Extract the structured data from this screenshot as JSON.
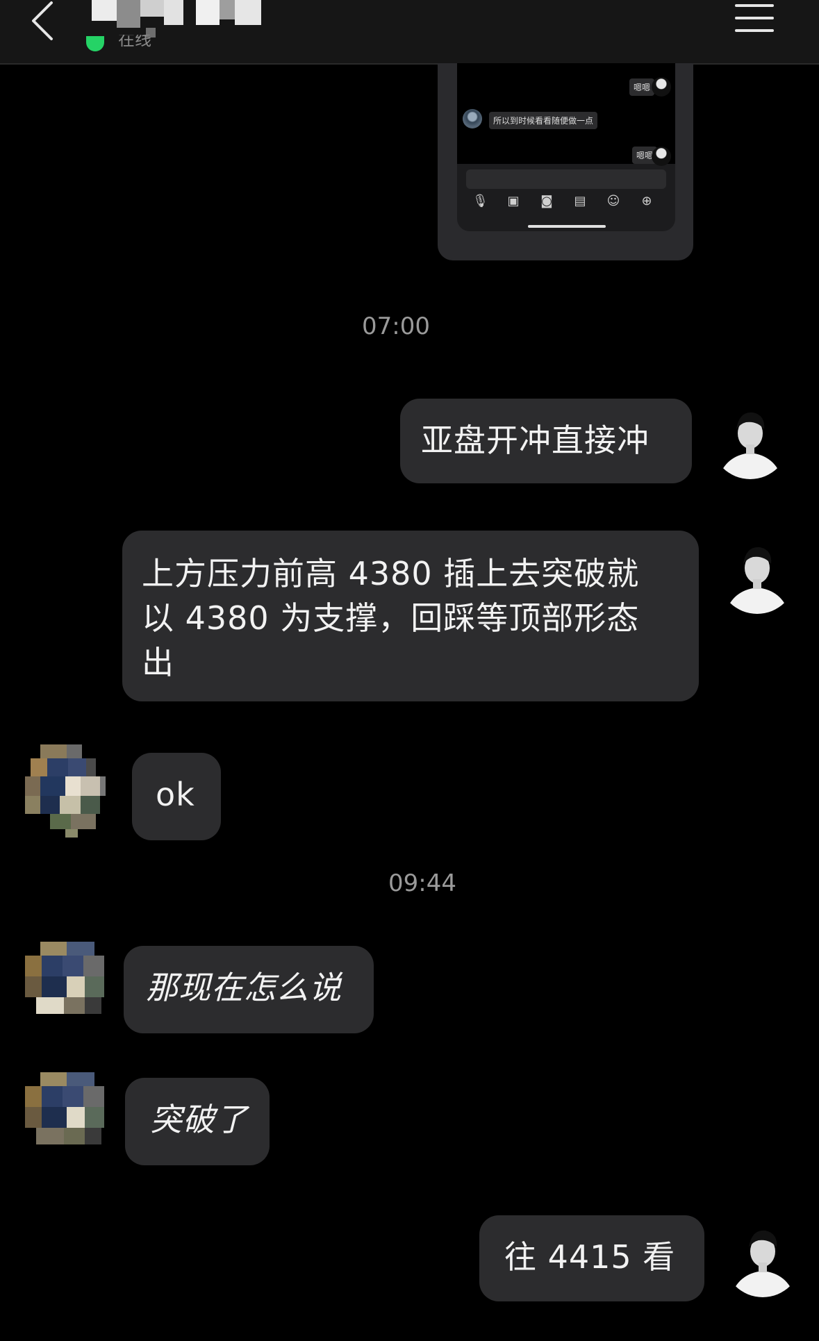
{
  "header": {
    "status": "在线",
    "online_color": "#25d366",
    "back_icon": "chevron-left-icon",
    "menu_icon": "menu-icon"
  },
  "embedded_screenshot": {
    "messages": [
      {
        "side": "right",
        "text": "嗯嗯"
      },
      {
        "side": "left",
        "text": "所以到时候看看随便做一点"
      },
      {
        "side": "right",
        "text": "嗯嗯"
      }
    ],
    "toolbar_icons": [
      "microphone-icon",
      "image-icon",
      "camera-icon",
      "red-packet-icon",
      "emoji-icon",
      "plus-icon"
    ]
  },
  "timestamps": {
    "first": "07:00",
    "second": "09:44"
  },
  "messages": [
    {
      "side": "right",
      "lines": [
        "亚盘开冲直接冲"
      ]
    },
    {
      "side": "right",
      "lines": [
        "上方压力前高 4380 插上去突破就",
        "以 4380 为支撑，回踩等顶部形态",
        "出"
      ]
    },
    {
      "side": "left",
      "lines": [
        "ok"
      ]
    },
    {
      "side": "left",
      "lines": [
        "那现在怎么说"
      ]
    },
    {
      "side": "left",
      "lines": [
        "突破了"
      ]
    },
    {
      "side": "right",
      "lines": [
        "往 4415 看"
      ]
    }
  ],
  "colors": {
    "background": "#000000",
    "bubble": "#2c2c2e",
    "header": "#161616",
    "timestamp": "#9a9a9a"
  }
}
